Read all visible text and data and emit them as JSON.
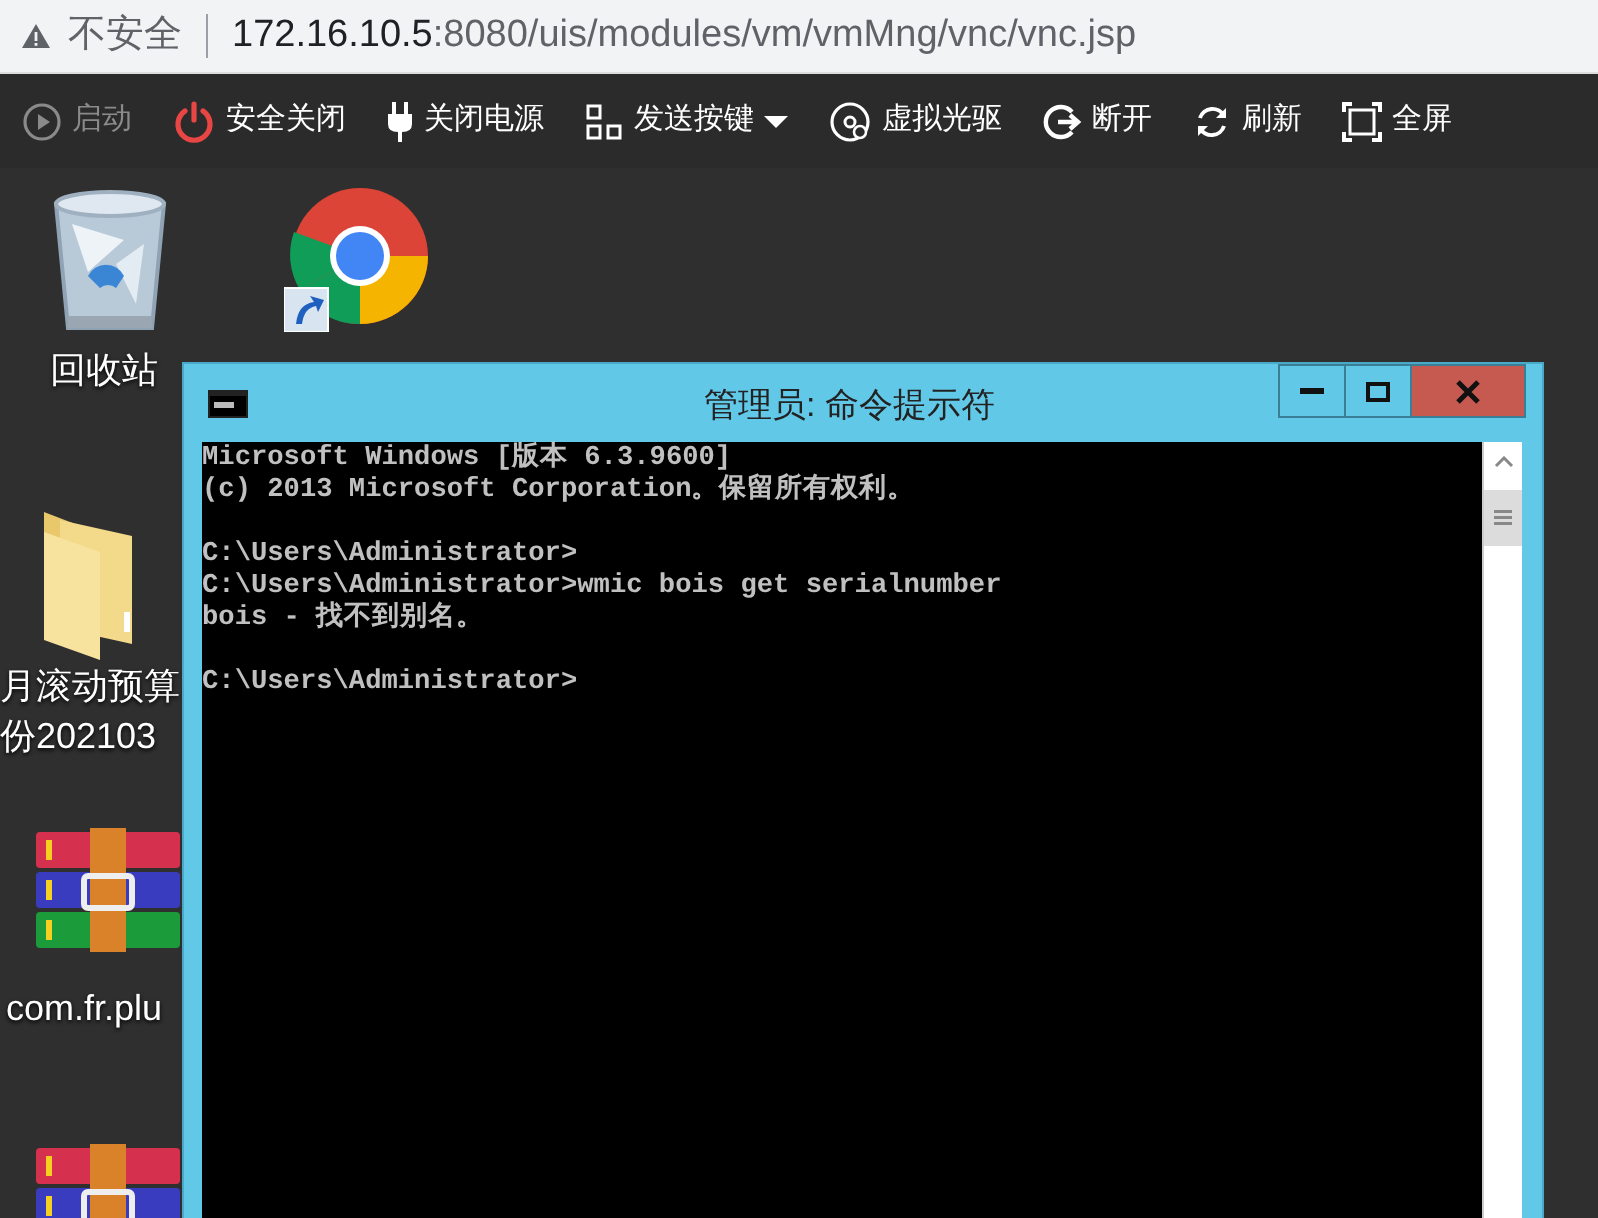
{
  "browser": {
    "security_label": "不安全",
    "url_host": "172.16.10.5",
    "url_path": ":8080/uis/modules/vm/vmMng/vnc/vnc.jsp"
  },
  "toolbar": [
    {
      "kind": "play",
      "label": "启动",
      "disabled": true,
      "has_menu": false
    },
    {
      "kind": "power",
      "label": "安全关闭",
      "disabled": false,
      "has_menu": false
    },
    {
      "kind": "plug",
      "label": "关闭电源",
      "disabled": false,
      "has_menu": false
    },
    {
      "kind": "keys",
      "label": "发送按键",
      "disabled": false,
      "has_menu": true
    },
    {
      "kind": "disc",
      "label": "虚拟光驱",
      "disabled": false,
      "has_menu": false
    },
    {
      "kind": "disconnect",
      "label": "断开",
      "disabled": false,
      "has_menu": false
    },
    {
      "kind": "refresh",
      "label": "刷新",
      "disabled": false,
      "has_menu": false
    },
    {
      "kind": "fullscreen",
      "label": "全屏",
      "disabled": false,
      "has_menu": false
    }
  ],
  "desktop_icons": [
    {
      "kind": "recycle",
      "label": [
        "回收站"
      ]
    },
    {
      "kind": "chrome"
    },
    {
      "kind": "folder",
      "label": [
        "月滚动预算",
        "份202103"
      ]
    },
    {
      "kind": "archive",
      "label": [
        "com.fr.plu"
      ]
    },
    {
      "kind": "archive"
    }
  ],
  "console_window": {
    "title": "管理员: 命令提示符",
    "lines": [
      [
        "Microsoft Windows [版本 6.3.9600]",
        "(c) 2013 Microsoft Corporation。保留所有权利。"
      ],
      [
        "C:\\Users\\Administrator>",
        "C:\\Users\\Administrator>wmic bois get serialnumber",
        "bois - 找不到别名。"
      ],
      [
        "C:\\Users\\Administrator>"
      ]
    ]
  }
}
